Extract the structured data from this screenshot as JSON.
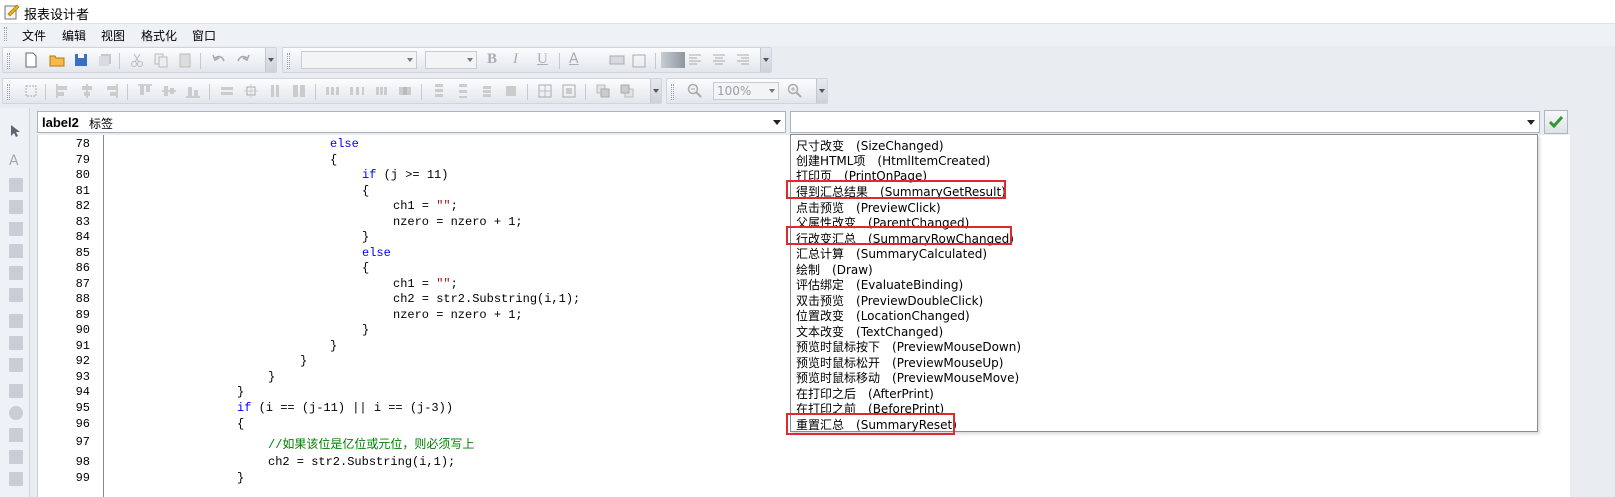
{
  "window": {
    "title": "报表设计者"
  },
  "menu": [
    "文件",
    "编辑",
    "视图",
    "格式化",
    "窗口"
  ],
  "toolbar": {
    "zoom": "100%"
  },
  "object_selector": {
    "name": "label2",
    "type": "标签"
  },
  "events": [
    {
      "cn": "尺寸改变",
      "en": "(SizeChanged)"
    },
    {
      "cn": "创建HTML项",
      "en": "(HtmlItemCreated)"
    },
    {
      "cn": "打印页",
      "en": "(PrintOnPage)"
    },
    {
      "cn": "得到汇总结果",
      "en": "(SummaryGetResult)"
    },
    {
      "cn": "点击预览",
      "en": "(PreviewClick)"
    },
    {
      "cn": "父属性改变",
      "en": "(ParentChanged)"
    },
    {
      "cn": "行改变汇总",
      "en": "(SummaryRowChanged)"
    },
    {
      "cn": "汇总计算",
      "en": "(SummaryCalculated)"
    },
    {
      "cn": "绘制",
      "en": "(Draw)"
    },
    {
      "cn": "评估绑定",
      "en": "(EvaluateBinding)"
    },
    {
      "cn": "双击预览",
      "en": "(PreviewDoubleClick)"
    },
    {
      "cn": "位置改变",
      "en": "(LocationChanged)"
    },
    {
      "cn": "文本改变",
      "en": "(TextChanged)"
    },
    {
      "cn": "预览时鼠标按下",
      "en": "(PreviewMouseDown)"
    },
    {
      "cn": "预览时鼠标松开",
      "en": "(PreviewMouseUp)"
    },
    {
      "cn": "预览时鼠标移动",
      "en": "(PreviewMouseMove)"
    },
    {
      "cn": "在打印之后",
      "en": "(AfterPrint)"
    },
    {
      "cn": "在打印之前",
      "en": "(BeforePrint)"
    },
    {
      "cn": "重置汇总",
      "en": "(SummaryReset)"
    }
  ],
  "highlighted_events": [
    "(SummaryGetResult)",
    "(SummaryRowChanged)",
    "(SummaryReset)"
  ],
  "code": {
    "line_numbers": [
      "78",
      "79",
      "80",
      "81",
      "82",
      "83",
      "84",
      "85",
      "86",
      "87",
      "88",
      "89",
      "90",
      "91",
      "92",
      "93",
      "94",
      "95",
      "96",
      "97",
      "98",
      "99"
    ],
    "lines": [
      "else",
      "{",
      "if (j >= 11)",
      "{",
      "ch1 = \"\";",
      "nzero = nzero + 1;",
      "}",
      "else",
      "{",
      "ch1 = \"\";",
      "ch2 = str2.Substring(i,1);",
      "nzero = nzero + 1;",
      "}",
      "}",
      "}",
      "}",
      "}",
      "if (i == (j-11) || i == (j-3))",
      "{",
      "//如果该位是亿位或元位，则必须写上",
      "ch2 = str2.Substring(i,1);",
      "}"
    ]
  }
}
